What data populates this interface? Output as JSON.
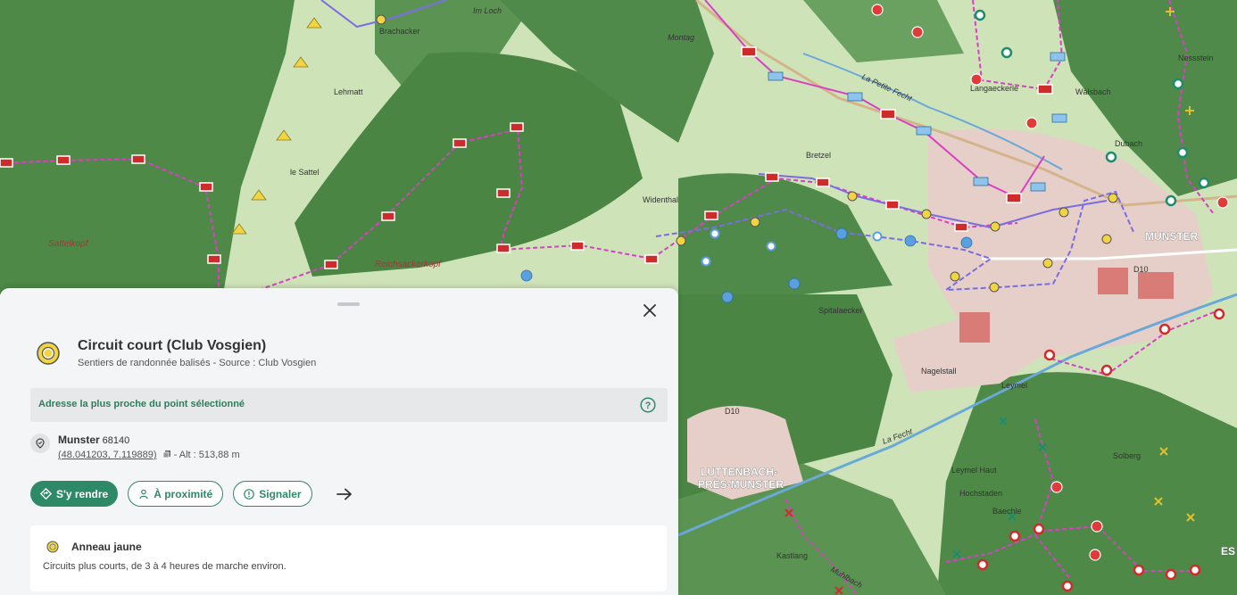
{
  "map": {
    "labels": {
      "brachacker": "Brachacker",
      "im_loch": "Im Loch",
      "montag": "Montag",
      "lehmatt": "Lehmatt",
      "sattel": "le Sattel",
      "sattelkopf": "Sattelkopf",
      "reichsackerkopf": "Reichsackerkopf",
      "widenthal": "Widenthal",
      "bretzel": "Bretzel",
      "langaeckerle": "Langaeckerle",
      "walsbach": "Wälsbach",
      "dubach": "Dubach",
      "nessstein": "Nessstein",
      "munster": "MUNSTER",
      "d10": "D10",
      "d10b": "D10",
      "spitalaecker": "Spitalaecker",
      "nagelstall": "Nagelstall",
      "leymel": "Leymel",
      "leymel_haut": "Leymel Haut",
      "hochstaden": "Hochstaden",
      "baechle": "Baechle",
      "solberg": "Solberg",
      "luttenbach1": "LUTTENBACH-",
      "luttenbach2": "PRÈS-MUNSTER",
      "kastlang": "Kastlang",
      "fecht": "La Fecht",
      "fecht2": "La Petite Fecht",
      "muhlbach": "Muhlbach",
      "esc": "ES"
    },
    "colors": {
      "forest": "#4f8a4a",
      "meadow": "#cfe3b9",
      "town": "#e9d4cf",
      "trail_pink": "#d93fc4",
      "trail_blue": "#7b6de0",
      "river": "#6aa8d8"
    }
  },
  "panel": {
    "close_icon": "close-icon",
    "title": "Circuit court (Club Vosgien)",
    "subtitle": "Sentiers de randonnée balisés - Source : Club Vosgien",
    "address_banner": "Adresse la plus proche du point sélectionné",
    "location": {
      "city": "Munster",
      "zip": "68140",
      "coords": "(48.041203, 7.119889)",
      "altitude": " - Alt : 513,88 m"
    },
    "buttons": {
      "go": "S'y rendre",
      "nearby": "À proximité",
      "report": "Signaler"
    },
    "card": {
      "title": "Anneau jaune",
      "description": "Circuits plus courts, de 3 à 4 heures de marche environ."
    }
  }
}
